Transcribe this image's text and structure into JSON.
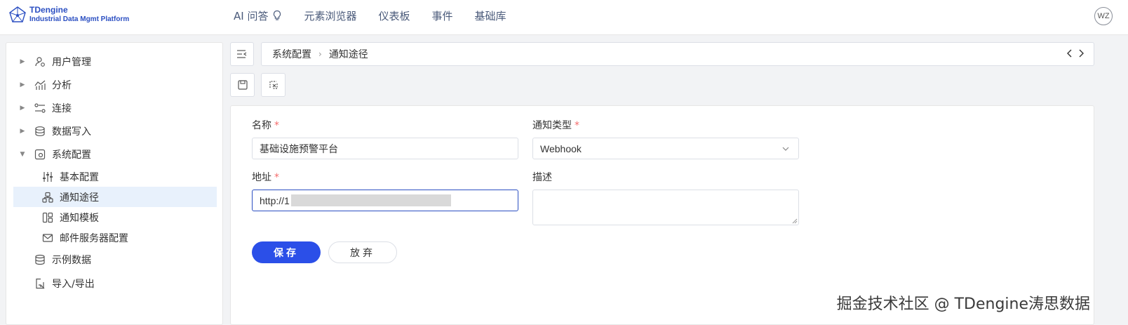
{
  "app": {
    "brand_name": "TDengine",
    "brand_sub": "Industrial Data Mgmt Platform"
  },
  "topnav": [
    {
      "label": "AI 问答"
    },
    {
      "label": "元素浏览器"
    },
    {
      "label": "仪表板"
    },
    {
      "label": "事件"
    },
    {
      "label": "基础库"
    }
  ],
  "user": {
    "initials": "WZ"
  },
  "sidebar": {
    "items": [
      {
        "label": "用户管理",
        "icon": "user-manage-icon"
      },
      {
        "label": "分析",
        "icon": "analytics-icon"
      },
      {
        "label": "连接",
        "icon": "connection-icon"
      },
      {
        "label": "数据写入",
        "icon": "data-write-icon"
      },
      {
        "label": "系统配置",
        "icon": "system-config-icon",
        "expanded": true
      }
    ],
    "sub_items": [
      {
        "label": "基本配置",
        "icon": "sliders-icon"
      },
      {
        "label": "通知途径",
        "icon": "notify-channel-icon",
        "active": true
      },
      {
        "label": "通知模板",
        "icon": "template-icon"
      },
      {
        "label": "邮件服务器配置",
        "icon": "mail-icon"
      }
    ],
    "bottom_items": [
      {
        "label": "示例数据",
        "icon": "database-icon"
      },
      {
        "label": "导入/导出",
        "icon": "import-export-icon"
      }
    ]
  },
  "breadcrumb": [
    "系统配置",
    "通知途径"
  ],
  "form": {
    "name_label": "名称",
    "name_value": "基础设施预警平台",
    "type_label": "通知类型",
    "type_value": "Webhook",
    "address_label": "地址",
    "address_value": "http://1",
    "description_label": "描述",
    "description_value": "",
    "required_mark": "*",
    "save_label": "保存",
    "discard_label": "放弃"
  },
  "watermark": "掘金技术社区 @ TDengine涛思数据",
  "colors": {
    "brand": "#2b4fc2",
    "primary_button": "#2b4fe8",
    "active_menu_bg": "#e8f1fc",
    "required": "#f56c6c"
  }
}
